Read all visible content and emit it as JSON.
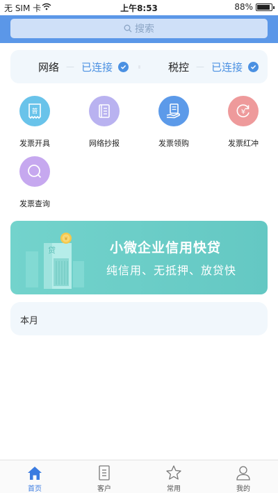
{
  "status_bar": {
    "carrier": "无 SIM 卡",
    "time": "上午8:53",
    "battery_percent": "88%",
    "battery_level": 0.88
  },
  "search": {
    "label": "搜索",
    "icon": "search-icon"
  },
  "connections": [
    {
      "name": "网络",
      "status": "已连接",
      "icon": "check-icon"
    },
    {
      "name": "税控",
      "status": "已连接",
      "icon": "check-icon"
    }
  ],
  "grid": [
    {
      "label": "发票开具",
      "icon": "receipt-icon",
      "color": "#69c3ea",
      "glyph": "普"
    },
    {
      "label": "网络抄报",
      "icon": "notebook-icon",
      "color": "#b9b2f0"
    },
    {
      "label": "发票领购",
      "icon": "hand-document-icon",
      "color": "#5c9ae9"
    },
    {
      "label": "发票红冲",
      "icon": "refresh-yen-icon",
      "color": "#ee9a9b",
      "glyph": "¥"
    },
    {
      "label": "发票查询",
      "icon": "magnifier-icon",
      "color": "#c6a8ef"
    }
  ],
  "banner": {
    "title": "小微企业信用快贷",
    "subtitle": "纯信用、无抵押、放贷快",
    "building_glyph": "贷",
    "coin_glyph": "¥",
    "background": "#69cdc7"
  },
  "month": {
    "label": "本月"
  },
  "tabs": [
    {
      "label": "首页",
      "icon": "home-icon",
      "active": true
    },
    {
      "label": "客户",
      "icon": "document-icon",
      "active": false
    },
    {
      "label": "常用",
      "icon": "star-icon",
      "active": false
    },
    {
      "label": "我的",
      "icon": "user-icon",
      "active": false
    }
  ],
  "colors": {
    "accent": "#4a90e2",
    "header": "#5b97e8",
    "tab_active": "#3a7be0"
  }
}
